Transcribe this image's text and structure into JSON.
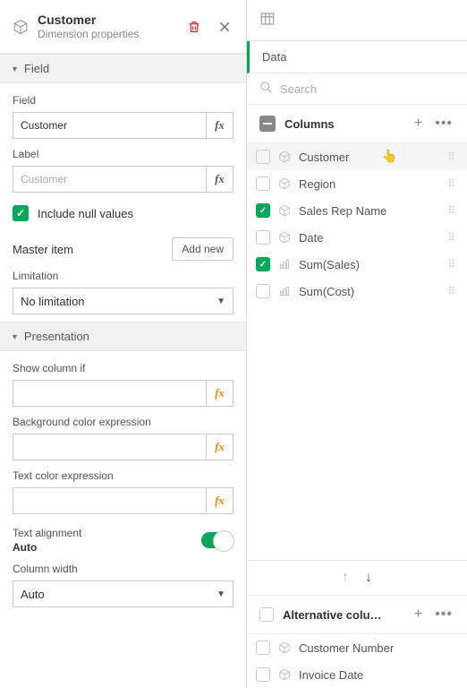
{
  "left": {
    "title": "Customer",
    "subtitle": "Dimension properties",
    "sections": {
      "field": "Field",
      "presentation": "Presentation"
    },
    "fieldGroup": {
      "fieldLabel": "Field",
      "fieldValue": "Customer",
      "labelLabel": "Label",
      "labelPlaceholder": "Customer",
      "includeNull": "Include null values",
      "masterItem": "Master item",
      "addNew": "Add new",
      "limitationLabel": "Limitation",
      "limitationValue": "No limitation"
    },
    "presentationGroup": {
      "showColumnIf": "Show column if",
      "bgExpr": "Background color expression",
      "textColorExpr": "Text color expression",
      "textAlignLabel": "Text alignment",
      "textAlignValue": "Auto",
      "colWidthLabel": "Column width",
      "colWidthValue": "Auto"
    },
    "fx": "fx"
  },
  "right": {
    "dataTitle": "Data",
    "searchPlaceholder": "Search",
    "columnsTitle": "Columns",
    "columns": [
      {
        "label": "Customer",
        "checked": false,
        "type": "cube",
        "hover": true
      },
      {
        "label": "Region",
        "checked": false,
        "type": "cube"
      },
      {
        "label": "Sales Rep Name",
        "checked": true,
        "type": "cube"
      },
      {
        "label": "Date",
        "checked": false,
        "type": "cube"
      },
      {
        "label": "Sum(Sales)",
        "checked": true,
        "type": "measure"
      },
      {
        "label": "Sum(Cost)",
        "checked": false,
        "type": "measure"
      }
    ],
    "altTitle": "Alternative colu…",
    "altItems": [
      {
        "label": "Customer Number",
        "type": "cube"
      },
      {
        "label": "Invoice Date",
        "type": "cube"
      }
    ]
  }
}
